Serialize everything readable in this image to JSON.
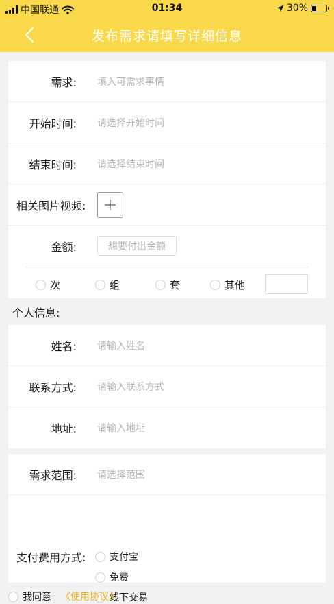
{
  "status": {
    "carrier": "中国联通",
    "time": "01:34",
    "battery": "30%",
    "battery_level": 0.3
  },
  "nav": {
    "title": "发布需求请填写详细信息",
    "back_icon": "chevron-left-icon"
  },
  "request": {
    "demand_label": "需求:",
    "demand_placeholder": "填入可需求事情",
    "start_label": "开始时间:",
    "start_placeholder": "请选择开始时间",
    "end_label": "结束时间:",
    "end_placeholder": "请选择结束时间",
    "media_label": "相关图片视频:",
    "amount_label": "金额:",
    "amount_placeholder": "想要付出金额",
    "units": [
      "次",
      "组",
      "套",
      "其他"
    ]
  },
  "personal": {
    "section_title": "个人信息:",
    "name_label": "姓名:",
    "name_placeholder": "请输入姓名",
    "contact_label": "联系方式:",
    "contact_placeholder": "请输入联系方式",
    "address_label": "地址:",
    "address_placeholder": "请输入地址"
  },
  "scope": {
    "scope_label": "需求范围:",
    "scope_placeholder": "请选择范围",
    "payment_label": "支付费用方式:",
    "payment_options": [
      "支付宝",
      "免费",
      "线下交易"
    ]
  },
  "agreement": {
    "agree_text": "我同意",
    "link_text": "《使用协议》"
  },
  "colors": {
    "header": "#f9d84a",
    "link": "#e8b424"
  }
}
